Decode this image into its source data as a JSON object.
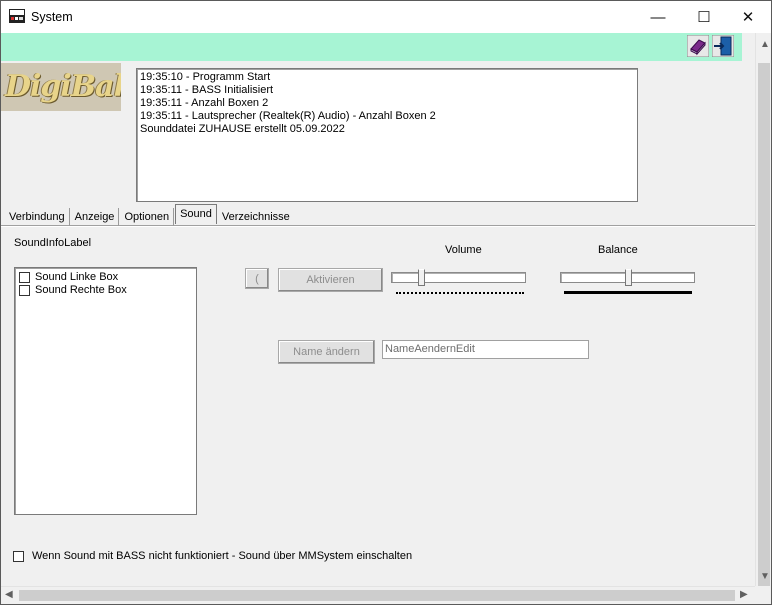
{
  "window": {
    "title": "System",
    "app_icon": "digibahn-app-icon",
    "controls": {
      "minimize": "—",
      "maximize": "☐",
      "close": "✕"
    }
  },
  "toolbar": {
    "icons": [
      "help-book-icon",
      "exit-door-icon"
    ],
    "background": "#a7f4d4"
  },
  "logo": {
    "text": "DigiBahn"
  },
  "log": {
    "lines": [
      "19:35:10 - Programm Start",
      "19:35:11 - BASS Initialisiert",
      "19:35:11 - Anzahl Boxen 2",
      "19:35:11 - Lautsprecher (Realtek(R) Audio) - Anzahl Boxen 2",
      "Sounddatei ZUHAUSE erstellt 05.09.2022"
    ]
  },
  "tabs": [
    {
      "label": "Verbindung",
      "active": false
    },
    {
      "label": "Anzeige",
      "active": false
    },
    {
      "label": "Optionen",
      "active": false
    },
    {
      "label": "Sound",
      "active": true
    },
    {
      "label": "Verzeichnisse",
      "active": false
    }
  ],
  "sound": {
    "info_label": "SoundInfoLabel",
    "boxes": [
      {
        "label": "Sound Linke Box",
        "checked": false
      },
      {
        "label": "Sound Rechte Box",
        "checked": false
      }
    ],
    "small_button_label": "(",
    "activate_button": "Aktivieren",
    "volume_label": "Volume",
    "volume_level": 0.2,
    "balance_label": "Balance",
    "balance_level": 0.5,
    "rename_button": "Name ändern",
    "rename_edit_value": "NameAendernEdit",
    "mmsystem_checkbox": "Wenn Sound mit BASS nicht funktioniert - Sound über MMSystem einschalten",
    "mmsystem_checked": false
  }
}
